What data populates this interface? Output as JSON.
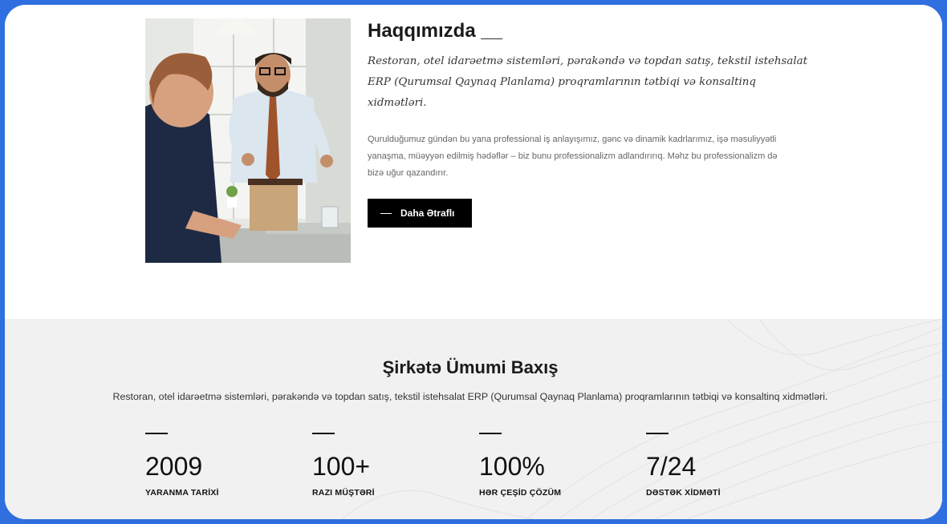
{
  "about": {
    "title": "Haqqımızda __",
    "lead": "Restoran, otel idarəetmə sistemləri, pərakəndə və topdan satış, tekstil istehsalat ERP (Qurumsal Qaynaq Planlama) proqramlarının tətbiqi və konsaltinq xidmətləri.",
    "body": "Qurulduğumuz gündən bu yana professional iş anlayışımız, gənc və dinamik kadrlarımız, işə məsuliyyətli yanaşma, müəyyən edilmiş hədəflər – biz bunu professionalizm adlandırırıq. Məhz bu professionalizm də bizə uğur qazandırır.",
    "button_label": "Daha Ətraflı"
  },
  "overview": {
    "title": "Şirkətə Ümumi Baxış",
    "subtitle": "Restoran, otel idarəetmə sistemləri, pərakəndə və topdan satış, tekstil istehsalat ERP (Qurumsal Qaynaq Planlama) proqramlarının tətbiqi və konsaltinq xidmətləri.",
    "stats": [
      {
        "value": "2009",
        "label": "YARANMA TARİXİ"
      },
      {
        "value": "100+",
        "label": "RAZI MÜŞTƏRİ"
      },
      {
        "value": "100%",
        "label": "HƏR ÇEŞİD ÇÖZÜM"
      },
      {
        "value": "7/24",
        "label": "DƏSTƏK XİDMƏTİ"
      }
    ]
  },
  "colors": {
    "frame_border": "#2f6fe0",
    "button_bg": "#000000",
    "overview_bg": "#f1f1f1"
  }
}
